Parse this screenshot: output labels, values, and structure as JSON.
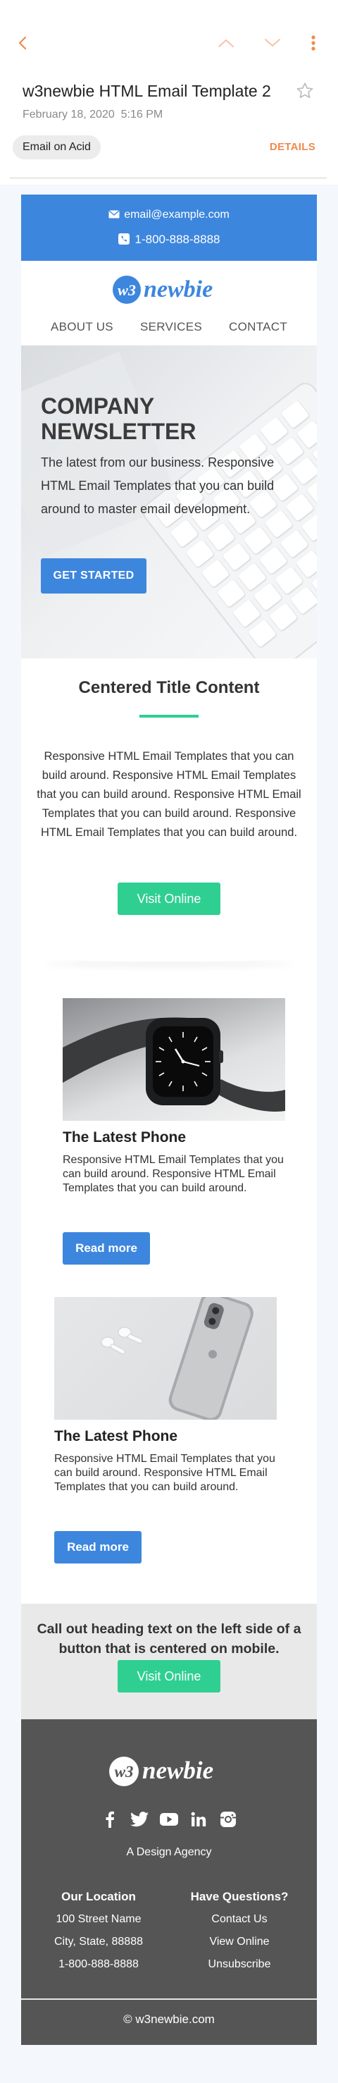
{
  "app": {
    "subject": "w3newbie HTML Email Template 2",
    "date": "February 18, 2020",
    "time": "5:16 PM",
    "sender": "Email on Acid",
    "details_label": "DETAILS",
    "accent_color": "#f08a4b"
  },
  "email": {
    "topbar": {
      "email": "email@example.com",
      "phone": "1-800-888-8888"
    },
    "logo_text": "newbie",
    "logo_mark": "w3",
    "nav": [
      "ABOUT US",
      "SERVICES",
      "CONTACT"
    ],
    "hero": {
      "title": "COMPANY NEWSLETTER",
      "text": "The latest from our business. Responsive HTML Email Templates that you can build around to master email development.",
      "button": "GET STARTED"
    },
    "centered": {
      "title": "Centered Title Content",
      "body": "Responsive HTML Email Templates that you can build around. Responsive HTML Email Templates that you can build around. Responsive HTML Email Templates that you can build around. Responsive HTML Email Templates that you can build around.",
      "button": "Visit Online"
    },
    "cards": [
      {
        "title": "The Latest Phone",
        "text": "Responsive HTML Email Templates that you can build around. Responsive HTML Email Templates that you can build around.",
        "button": "Read more"
      },
      {
        "title": "The Latest Phone",
        "text": "Responsive HTML Email Templates that you can build around. Responsive HTML Email Templates that you can build around.",
        "button": "Read more"
      }
    ],
    "callout": {
      "text": "Call out heading text on the left side of a button that is centered on mobile.",
      "button": "Visit Online"
    },
    "footer": {
      "tagline": "A Design Agency",
      "col1": {
        "heading": "Our Location",
        "lines": [
          "100 Street Name",
          "City, State, 88888",
          "1-800-888-8888"
        ]
      },
      "col2": {
        "heading": "Have Questions?",
        "lines": [
          "Contact Us",
          "View Online",
          "Unsubscribe"
        ]
      },
      "copyright": "© w3newbie.com"
    },
    "colors": {
      "blue": "#3d86de",
      "green": "#2fcf92",
      "footer": "#555555"
    }
  }
}
